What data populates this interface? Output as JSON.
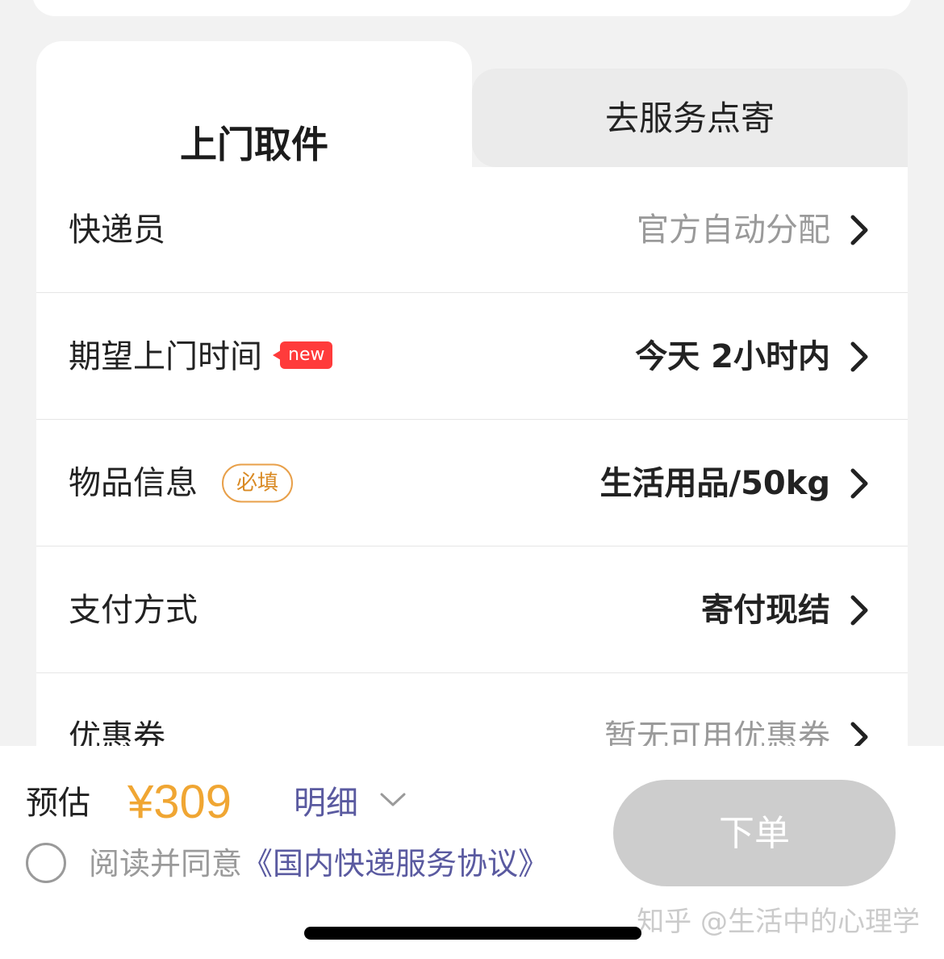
{
  "tabs": {
    "active": "上门取件",
    "inactive": "去服务点寄"
  },
  "rows": [
    {
      "label": "快递员",
      "value": "官方自动分配"
    },
    {
      "label": "期望上门时间",
      "badge": "new",
      "value": "今天 2小时内"
    },
    {
      "label": "物品信息",
      "badge": "必填",
      "value": "生活用品/50kg"
    },
    {
      "label": "支付方式",
      "value": "寄付现结"
    },
    {
      "label": "优惠券",
      "value": "暂无可用优惠券"
    }
  ],
  "footer": {
    "estimate_label": "预估",
    "price": "¥309",
    "detail_label": "明细",
    "agree_prefix": "阅读并同意",
    "agree_link": "《国内快递服务协议》",
    "order_button": "下单"
  },
  "watermark": "知乎 @生活中的心理学",
  "colors": {
    "price": "#f0a633",
    "link": "#5a5aa0",
    "new_badge": "#ff3b3b",
    "required_badge": "#e8a04a",
    "order_button_disabled": "#cdcdcd"
  }
}
